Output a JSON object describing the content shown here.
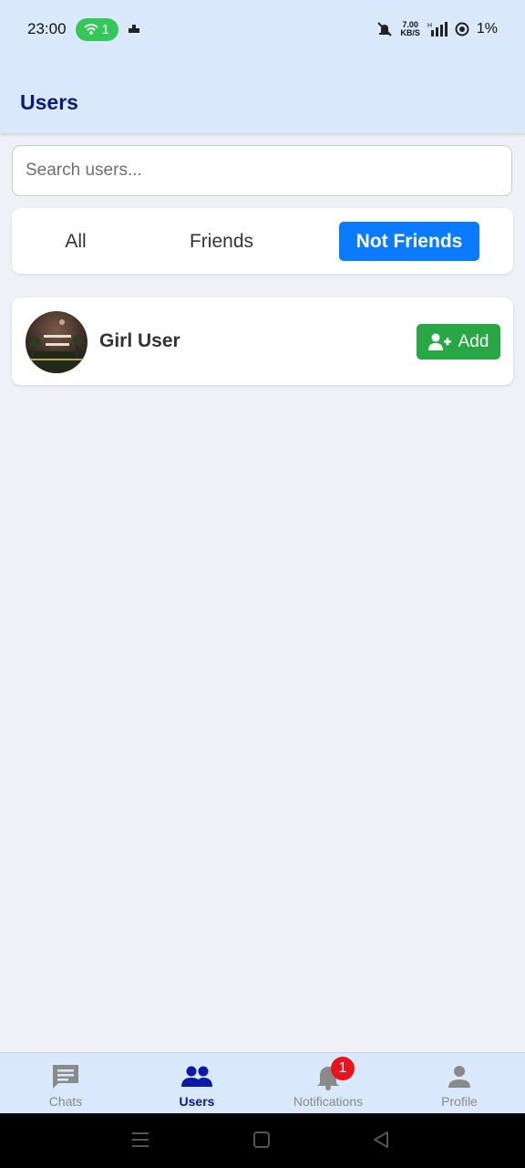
{
  "status_bar": {
    "time": "23:00",
    "hotspot_count": "1",
    "net_speed_value": "7.00",
    "net_speed_unit": "KB/S",
    "signal_type": "H",
    "battery": "1%"
  },
  "header": {
    "title": "Users"
  },
  "search": {
    "placeholder": "Search users...",
    "value": ""
  },
  "tabs": [
    {
      "label": "All",
      "active": false
    },
    {
      "label": "Friends",
      "active": false
    },
    {
      "label": "Not Friends",
      "active": true
    }
  ],
  "users": [
    {
      "name": "Girl User",
      "action_label": "Add",
      "avatar_icon": "user-photo"
    }
  ],
  "bottom_nav": [
    {
      "label": "Chats",
      "icon": "chat-icon",
      "active": false
    },
    {
      "label": "Users",
      "icon": "users-icon",
      "active": true
    },
    {
      "label": "Notifications",
      "icon": "bell-icon",
      "active": false,
      "badge": "1"
    },
    {
      "label": "Profile",
      "icon": "profile-icon",
      "active": false
    }
  ],
  "colors": {
    "header_bg": "#d9e8fb",
    "title": "#0c1a80",
    "active_tab": "#0a7bff",
    "add_button": "#28a745",
    "badge": "#e5141e"
  }
}
